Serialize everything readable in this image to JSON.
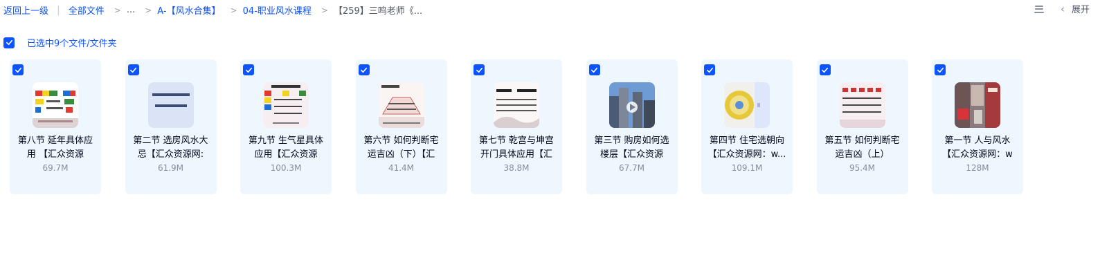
{
  "breadcrumb": {
    "back": "返回上一级",
    "all_files": "全部文件",
    "ellipsis": "...",
    "folder1": "A-【风水合集】",
    "folder2": "04-职业风水课程",
    "current": "【259】三鸣老师《..."
  },
  "topright": {
    "expand_label": "展开"
  },
  "selection": {
    "label": "已选中9个文件/文件夹"
  },
  "files": [
    {
      "name_line1": "第八节 延年具体应",
      "name_line2": "用 【汇众资源",
      "size": "69.7M"
    },
    {
      "name_line1": "第二节 选房风水大",
      "name_line2": "忌【汇众资源网:",
      "size": "61.9M"
    },
    {
      "name_line1": "第九节 生气星具体",
      "name_line2": "应用【汇众资源",
      "size": "100.3M"
    },
    {
      "name_line1": "第六节 如何判断宅",
      "name_line2": "运吉凶（下）【汇",
      "size": "41.4M"
    },
    {
      "name_line1": "第七节 乾宫与坤宫",
      "name_line2": "开门具体应用【汇",
      "size": "38.8M"
    },
    {
      "name_line1": "第三节 购房如何选",
      "name_line2": "楼层【汇众资源",
      "size": "67.7M"
    },
    {
      "name_line1": "第四节 住宅选朝向",
      "name_line2": "【汇众资源网：w...",
      "size": "109.1M"
    },
    {
      "name_line1": "第五节 如何判断宅",
      "name_line2": "运吉凶（上）",
      "size": "95.4M"
    },
    {
      "name_line1": "第一节 人与风水",
      "name_line2": "【汇众资源网：w",
      "size": "128M"
    }
  ],
  "colors": {
    "accent": "#0d53ff",
    "card_bg": "#eef6fe"
  }
}
